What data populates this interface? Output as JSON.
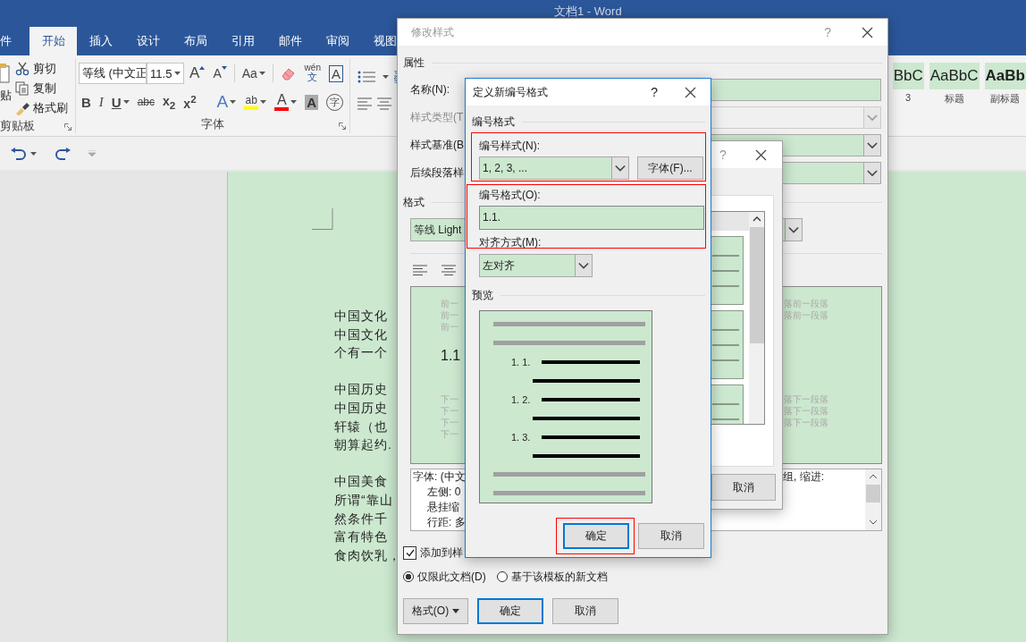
{
  "window": {
    "title": "文档1 - Word"
  },
  "tabs": [
    {
      "label": "件",
      "selected": false
    },
    {
      "label": "开始",
      "selected": true
    },
    {
      "label": "插入",
      "selected": false
    },
    {
      "label": "设计",
      "selected": false
    },
    {
      "label": "布局",
      "selected": false
    },
    {
      "label": "引用",
      "selected": false
    },
    {
      "label": "邮件",
      "selected": false
    },
    {
      "label": "审阅",
      "selected": false
    },
    {
      "label": "视图",
      "selected": false
    }
  ],
  "clipboard": {
    "paste_label": "贴",
    "items": [
      {
        "kind": "cut",
        "label": "剪切"
      },
      {
        "kind": "copy",
        "label": "复制"
      },
      {
        "kind": "painter",
        "label": "格式刷"
      }
    ],
    "group_label": "剪贴板"
  },
  "font": {
    "font_name": "等线 (中文正",
    "font_size": "11.5",
    "row_1": [
      {
        "kind": "grow",
        "text": "A"
      },
      {
        "kind": "shrink",
        "text": "A"
      },
      {
        "kind": "case",
        "text": "Aa"
      },
      {
        "kind": "eraser"
      },
      {
        "kind": "phonetic",
        "text": "wén",
        "subtext": "文"
      },
      {
        "kind": "boxed",
        "text": "A"
      }
    ],
    "row_2": [
      {
        "kind": "bold",
        "text": "B"
      },
      {
        "kind": "italic",
        "text": "I"
      },
      {
        "kind": "underline",
        "text": "U"
      },
      {
        "kind": "strike",
        "text": "abc"
      },
      {
        "kind": "sub",
        "text": "x$_{2}$"
      },
      {
        "kind": "sup",
        "text": "x$^{2}$"
      },
      {
        "kind": "effect",
        "text": "A"
      },
      {
        "kind": "highlight",
        "text": "ab",
        "color": "#ffff00"
      },
      {
        "kind": "fontcolor",
        "text": "A",
        "color": "#ff0000"
      },
      {
        "kind": "shade",
        "text": "A"
      },
      {
        "kind": "enclose",
        "text": "字"
      }
    ],
    "group_label": "字体"
  },
  "styles_gallery": [
    {
      "sample": "BbC",
      "label": "3"
    },
    {
      "sample": "AaBbC",
      "label": "标题"
    },
    {
      "sample": "AaBb",
      "label": "副标题"
    }
  ],
  "document": {
    "paragraphs": [
      [
        "中国文化",
        "中国文化",
        "个有一个"
      ],
      [
        "中国历史",
        "中国历史",
        "轩辕（也",
        "朝算起约."
      ],
      [
        "中国美食",
        "所谓“靠山",
        "然条件千",
        "富有特色",
        "食肉饮乳，"
      ]
    ]
  },
  "modify_dialog": {
    "title": "修改样式",
    "help": "?",
    "properties_label": "属性",
    "fields": [
      {
        "label": "名称(N):",
        "dropdown": false,
        "disabled": false
      },
      {
        "label": "样式类型(T",
        "dropdown": true,
        "disabled": true
      },
      {
        "label": "样式基准(B",
        "dropdown": true,
        "disabled": false
      },
      {
        "label": "后续段落样",
        "dropdown": true,
        "disabled": false
      }
    ],
    "format_label": "格式",
    "font_value": "等线 Light",
    "preview": {
      "before": [
        "前一",
        "前一",
        "前一"
      ],
      "sample": "1.1",
      "after": [
        "下一",
        "下一",
        "下一",
        "下一"
      ],
      "before_right": [
        "落前一段落",
        "落前一段落"
      ],
      "after_right": [
        "落下一段落",
        "落下一段落",
        "落下一段落"
      ]
    },
    "description": {
      "lines": [
        "字体: (中文",
        "左侧: 0",
        "悬挂缩",
        "行距: 多"
      ],
      "right": "组, 缩进:"
    },
    "add_to_gallery": {
      "label": "添加到样",
      "checked": true
    },
    "scope": [
      {
        "label": "仅限此文档(D)",
        "selected": true
      },
      {
        "label": "基于该模板的新文档",
        "selected": false
      }
    ],
    "format_button": "格式(O)",
    "ok": "确定",
    "cancel": "取消"
  },
  "library_dialog": {
    "help": "?",
    "cancel": "取消"
  },
  "numbering_dialog": {
    "title": "定义新编号格式",
    "help": "?",
    "section_label": "编号格式",
    "style_group": {
      "highlighted": true,
      "label": "编号样式(N):",
      "value": "1, 2, 3, ...",
      "font_button": "字体(F)..."
    },
    "format_group": {
      "highlighted": true,
      "label": "编号格式(O):",
      "value": "1.1.",
      "align_label": "对齐方式(M):"
    },
    "align_value": "左对齐",
    "preview_label": "预览",
    "preview_items": [
      "1. 1.",
      "1. 2.",
      "1. 3."
    ],
    "ok": {
      "label": "确定",
      "highlighted": true
    },
    "cancel": "取消"
  }
}
